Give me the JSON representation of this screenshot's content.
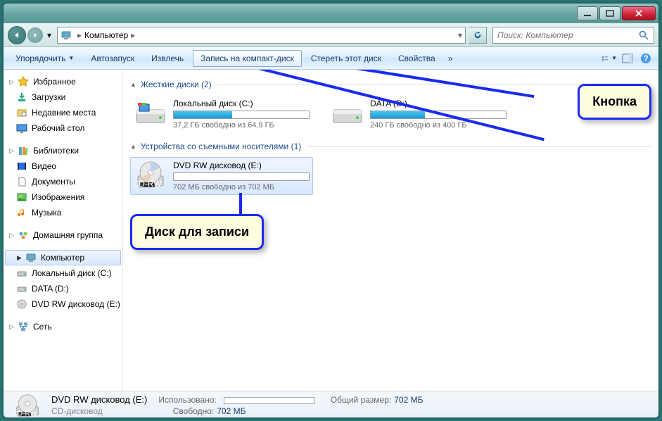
{
  "breadcrumb": {
    "root": "Компьютер"
  },
  "search": {
    "placeholder": "Поиск: Компьютер"
  },
  "toolbar": {
    "organize": "Упорядочить",
    "autoplay": "Автозапуск",
    "eject": "Извлечь",
    "burn": "Запись на компакт-диск",
    "erase": "Стереть этот диск",
    "properties": "Свойства"
  },
  "sidebar": {
    "favorites": {
      "label": "Избранное",
      "items": [
        "Загрузки",
        "Недавние места",
        "Рабочий стол"
      ]
    },
    "libraries": {
      "label": "Библиотеки",
      "items": [
        "Видео",
        "Документы",
        "Изображения",
        "Музыка"
      ]
    },
    "homegroup": {
      "label": "Домашняя группа"
    },
    "computer": {
      "label": "Компьютер",
      "items": [
        "Локальный диск (C:)",
        "DATA (D:)",
        "DVD RW дисковод (E:)"
      ]
    },
    "network": {
      "label": "Сеть"
    }
  },
  "groups": {
    "hdd": {
      "label": "Жесткие диски (2)"
    },
    "removable": {
      "label": "Устройства со съемными носителями (1)"
    }
  },
  "drives": {
    "c": {
      "name": "Локальный диск (C:)",
      "free": "37,2 ГБ свободно из 64,9 ГБ",
      "fill": 43
    },
    "d": {
      "name": "DATA (D:)",
      "free": "240 ГБ свободно из 400 ГБ",
      "fill": 40
    },
    "e": {
      "name": "DVD RW дисковод (E:)",
      "free": "702 МБ свободно из 702 МБ",
      "fill": 0
    }
  },
  "callouts": {
    "button": "Кнопка",
    "disc": "Диск для записи"
  },
  "statusbar": {
    "title": "DVD RW дисковод (E:)",
    "subtitle": "CD-дисковод",
    "used_label": "Использовано:",
    "total_label": "Общий размер:",
    "total_value": "702 МБ",
    "free_label": "Свободно:",
    "free_value": "702 МБ"
  }
}
